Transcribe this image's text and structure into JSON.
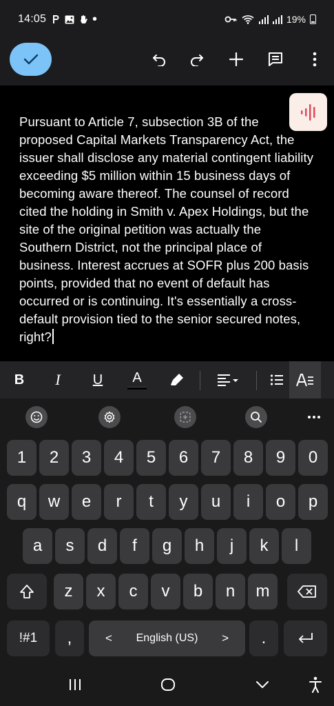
{
  "status_bar": {
    "time": "14:05",
    "notification_icons": [
      "parking-icon",
      "image-icon",
      "hand-icon",
      "dot-icon"
    ],
    "battery": "19%"
  },
  "toolbar": {
    "done_icon": "check-icon",
    "actions": [
      "undo-icon",
      "redo-icon",
      "plus-icon",
      "comment-icon",
      "more-vert-icon"
    ]
  },
  "document": {
    "text": "Pursuant to Article 7, subsection 3B of the proposed Capital Markets Transparency Act, the issuer shall disclose any material contingent liability exceeding $5 million within 15 business days of becoming aware thereof. The counsel of record cited the holding in Smith v. Apex Holdings, but the site of the original petition was actually the Southern District, not the principal place of business. Interest accrues at SOFR plus 200 basis points, provided that no event of default has occurred or is continuing. It's essentially a cross-default provision tied to the senior secured notes, right?"
  },
  "format_bar": {
    "bold": "B",
    "italic": "I",
    "underline": "U",
    "text_color": "A",
    "text_color_swatch": "#000000"
  },
  "keyboard": {
    "number_row": [
      "1",
      "2",
      "3",
      "4",
      "5",
      "6",
      "7",
      "8",
      "9",
      "0"
    ],
    "row1": [
      "q",
      "w",
      "e",
      "r",
      "t",
      "y",
      "u",
      "i",
      "o",
      "p"
    ],
    "row2": [
      "a",
      "s",
      "d",
      "f",
      "g",
      "h",
      "j",
      "k",
      "l"
    ],
    "row3": [
      "z",
      "x",
      "c",
      "v",
      "b",
      "n",
      "m"
    ],
    "symbols_label": "!#1",
    "comma": ",",
    "space_label": "English (US)",
    "left_arrow": "<",
    "right_arrow": ">",
    "period": "."
  },
  "colors": {
    "accent_button": "#7cc4f8",
    "voice_button_bg": "#fbeee8",
    "voice_icon": "#e0485a"
  }
}
